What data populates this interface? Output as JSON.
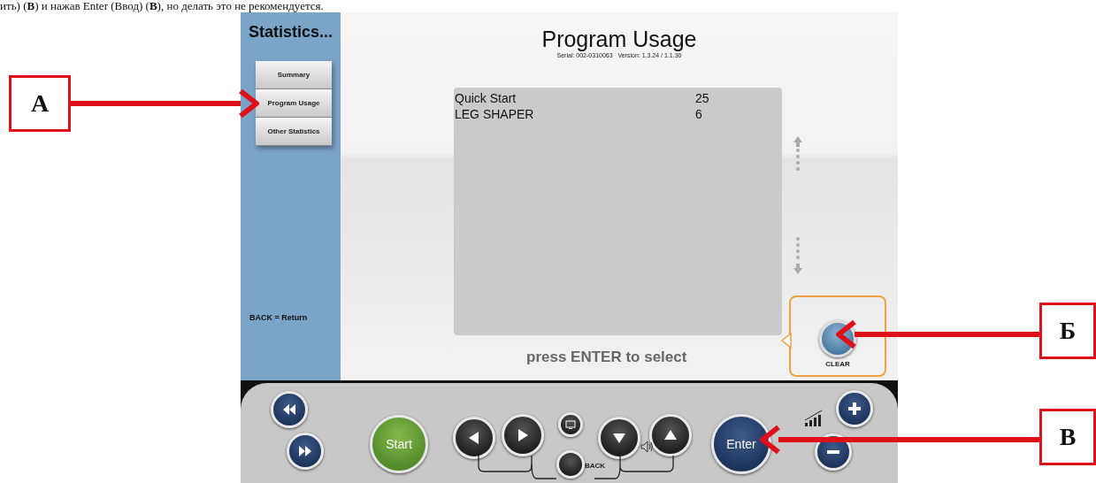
{
  "document_text": "ить) (**В**) и нажав Enter (Ввод) (**В**), но делать это не рекомендуется.",
  "sidebar": {
    "title": "Statistics...",
    "items": [
      {
        "label": "Summary"
      },
      {
        "label": "Program Usage"
      },
      {
        "label": "Other Statistics"
      }
    ],
    "hint": "BACK = Return"
  },
  "main": {
    "title": "Program Usage",
    "subtitle": "Serial: 002-0310063   Version: 1.3.24 / 1.1.30",
    "rows": [
      {
        "name": "Quick Start",
        "count": "25"
      },
      {
        "name": "LEG SHAPER",
        "count": "6"
      }
    ],
    "hint": "press ENTER to select"
  },
  "clear_button": {
    "label": "CLEAR"
  },
  "console": {
    "start": "Start",
    "back": "BACK",
    "enter": "Enter"
  },
  "annotations": [
    {
      "label": "A"
    },
    {
      "label": "Б"
    },
    {
      "label": "В"
    }
  ]
}
